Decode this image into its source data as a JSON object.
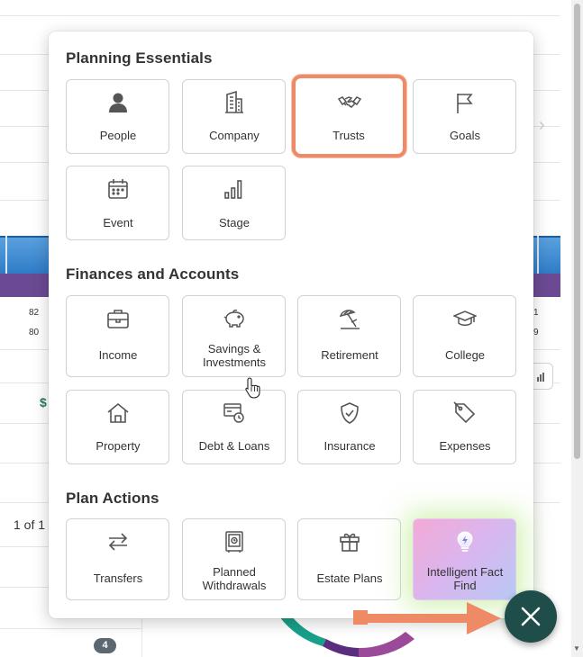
{
  "background": {
    "numbers": [
      "82",
      "80"
    ],
    "right_numbers": [
      "1",
      "9"
    ],
    "dollar": "$",
    "pagination": "1 of 1",
    "badge_count": "4"
  },
  "sections": [
    {
      "title": "Planning Essentials",
      "tiles": [
        {
          "label": "People",
          "icon": "person-icon"
        },
        {
          "label": "Company",
          "icon": "building-icon"
        },
        {
          "label": "Trusts",
          "icon": "handshake-icon"
        },
        {
          "label": "Goals",
          "icon": "flag-icon"
        },
        {
          "label": "Event",
          "icon": "calendar-icon"
        },
        {
          "label": "Stage",
          "icon": "bar-chart-icon"
        }
      ]
    },
    {
      "title": "Finances and Accounts",
      "tiles": [
        {
          "label": "Income",
          "icon": "briefcase-icon"
        },
        {
          "label": "Savings & Investments",
          "icon": "piggy-bank-icon"
        },
        {
          "label": "Retirement",
          "icon": "beach-umbrella-icon"
        },
        {
          "label": "College",
          "icon": "graduation-cap-icon"
        },
        {
          "label": "Property",
          "icon": "house-icon"
        },
        {
          "label": "Debt & Loans",
          "icon": "debt-icon"
        },
        {
          "label": "Insurance",
          "icon": "shield-check-icon"
        },
        {
          "label": "Expenses",
          "icon": "tag-icon"
        }
      ]
    },
    {
      "title": "Plan Actions",
      "tiles": [
        {
          "label": "Transfers",
          "icon": "transfer-arrows-icon"
        },
        {
          "label": "Planned Withdrawals",
          "icon": "safe-icon"
        },
        {
          "label": "Estate Plans",
          "icon": "gift-icon"
        },
        {
          "label": "Intelligent Fact Find",
          "icon": "lightbulb-icon"
        }
      ]
    }
  ],
  "colors": {
    "highlight": "#ef8a66",
    "fab": "#1f4e4a",
    "annotation_arrow": "#ef8a66"
  }
}
